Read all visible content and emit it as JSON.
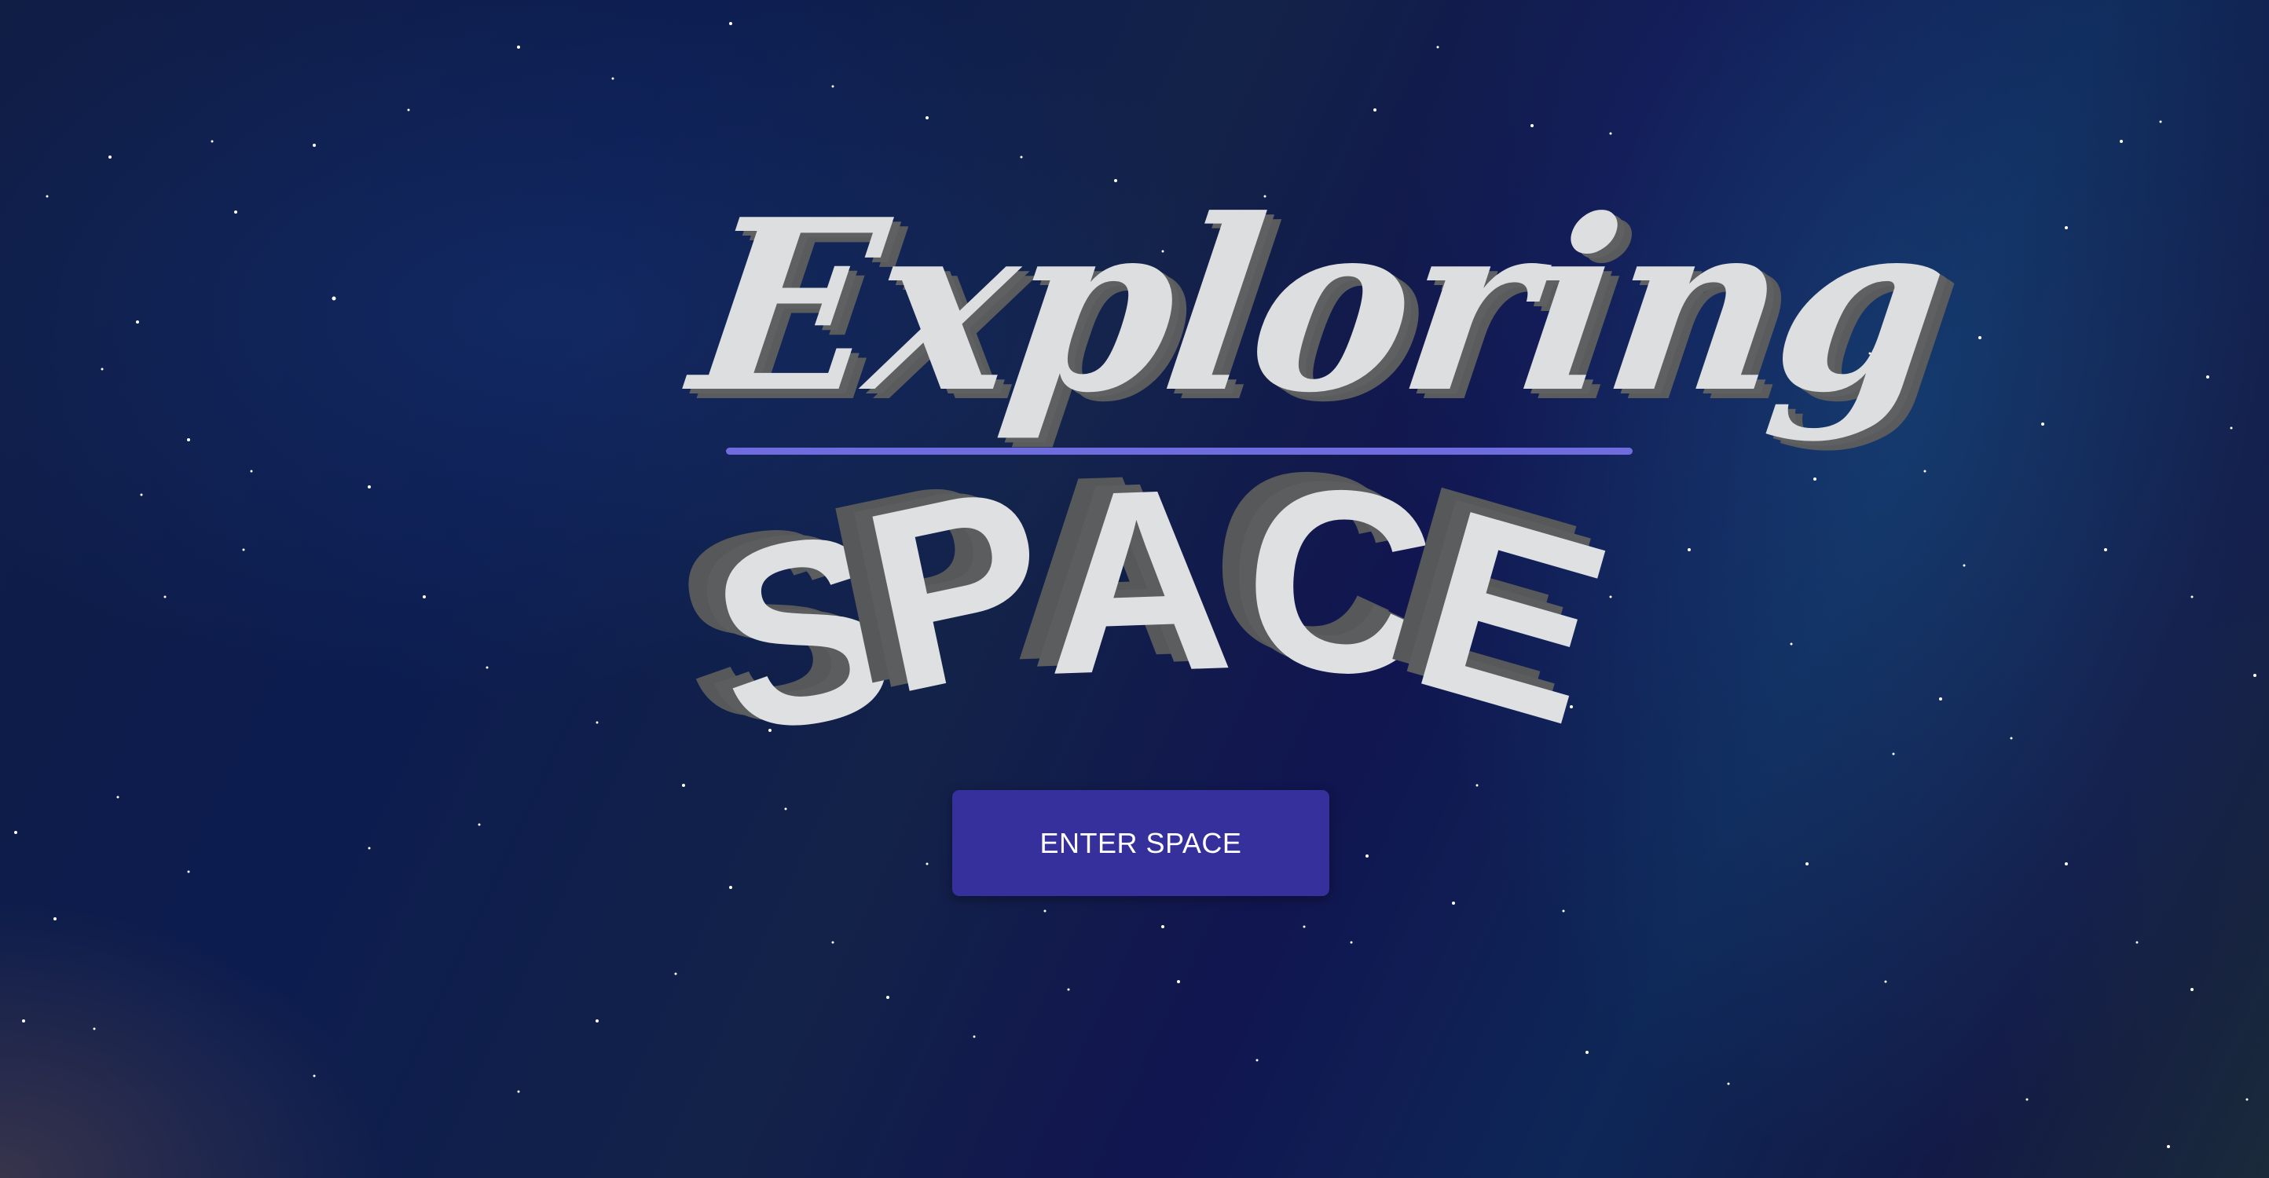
{
  "hero": {
    "title_script": "Exploring",
    "title_letters": [
      "S",
      "P",
      "A",
      "C",
      "E"
    ]
  },
  "cta": {
    "label": "ENTER SPACE"
  },
  "colors": {
    "title_fill": "#dcdedf",
    "title_shadow": "#5a5b5d",
    "underline": "#6f6ce0",
    "button_bg": "#36309c",
    "button_text": "#ffffff",
    "background_dark": "#0c1c4f"
  }
}
